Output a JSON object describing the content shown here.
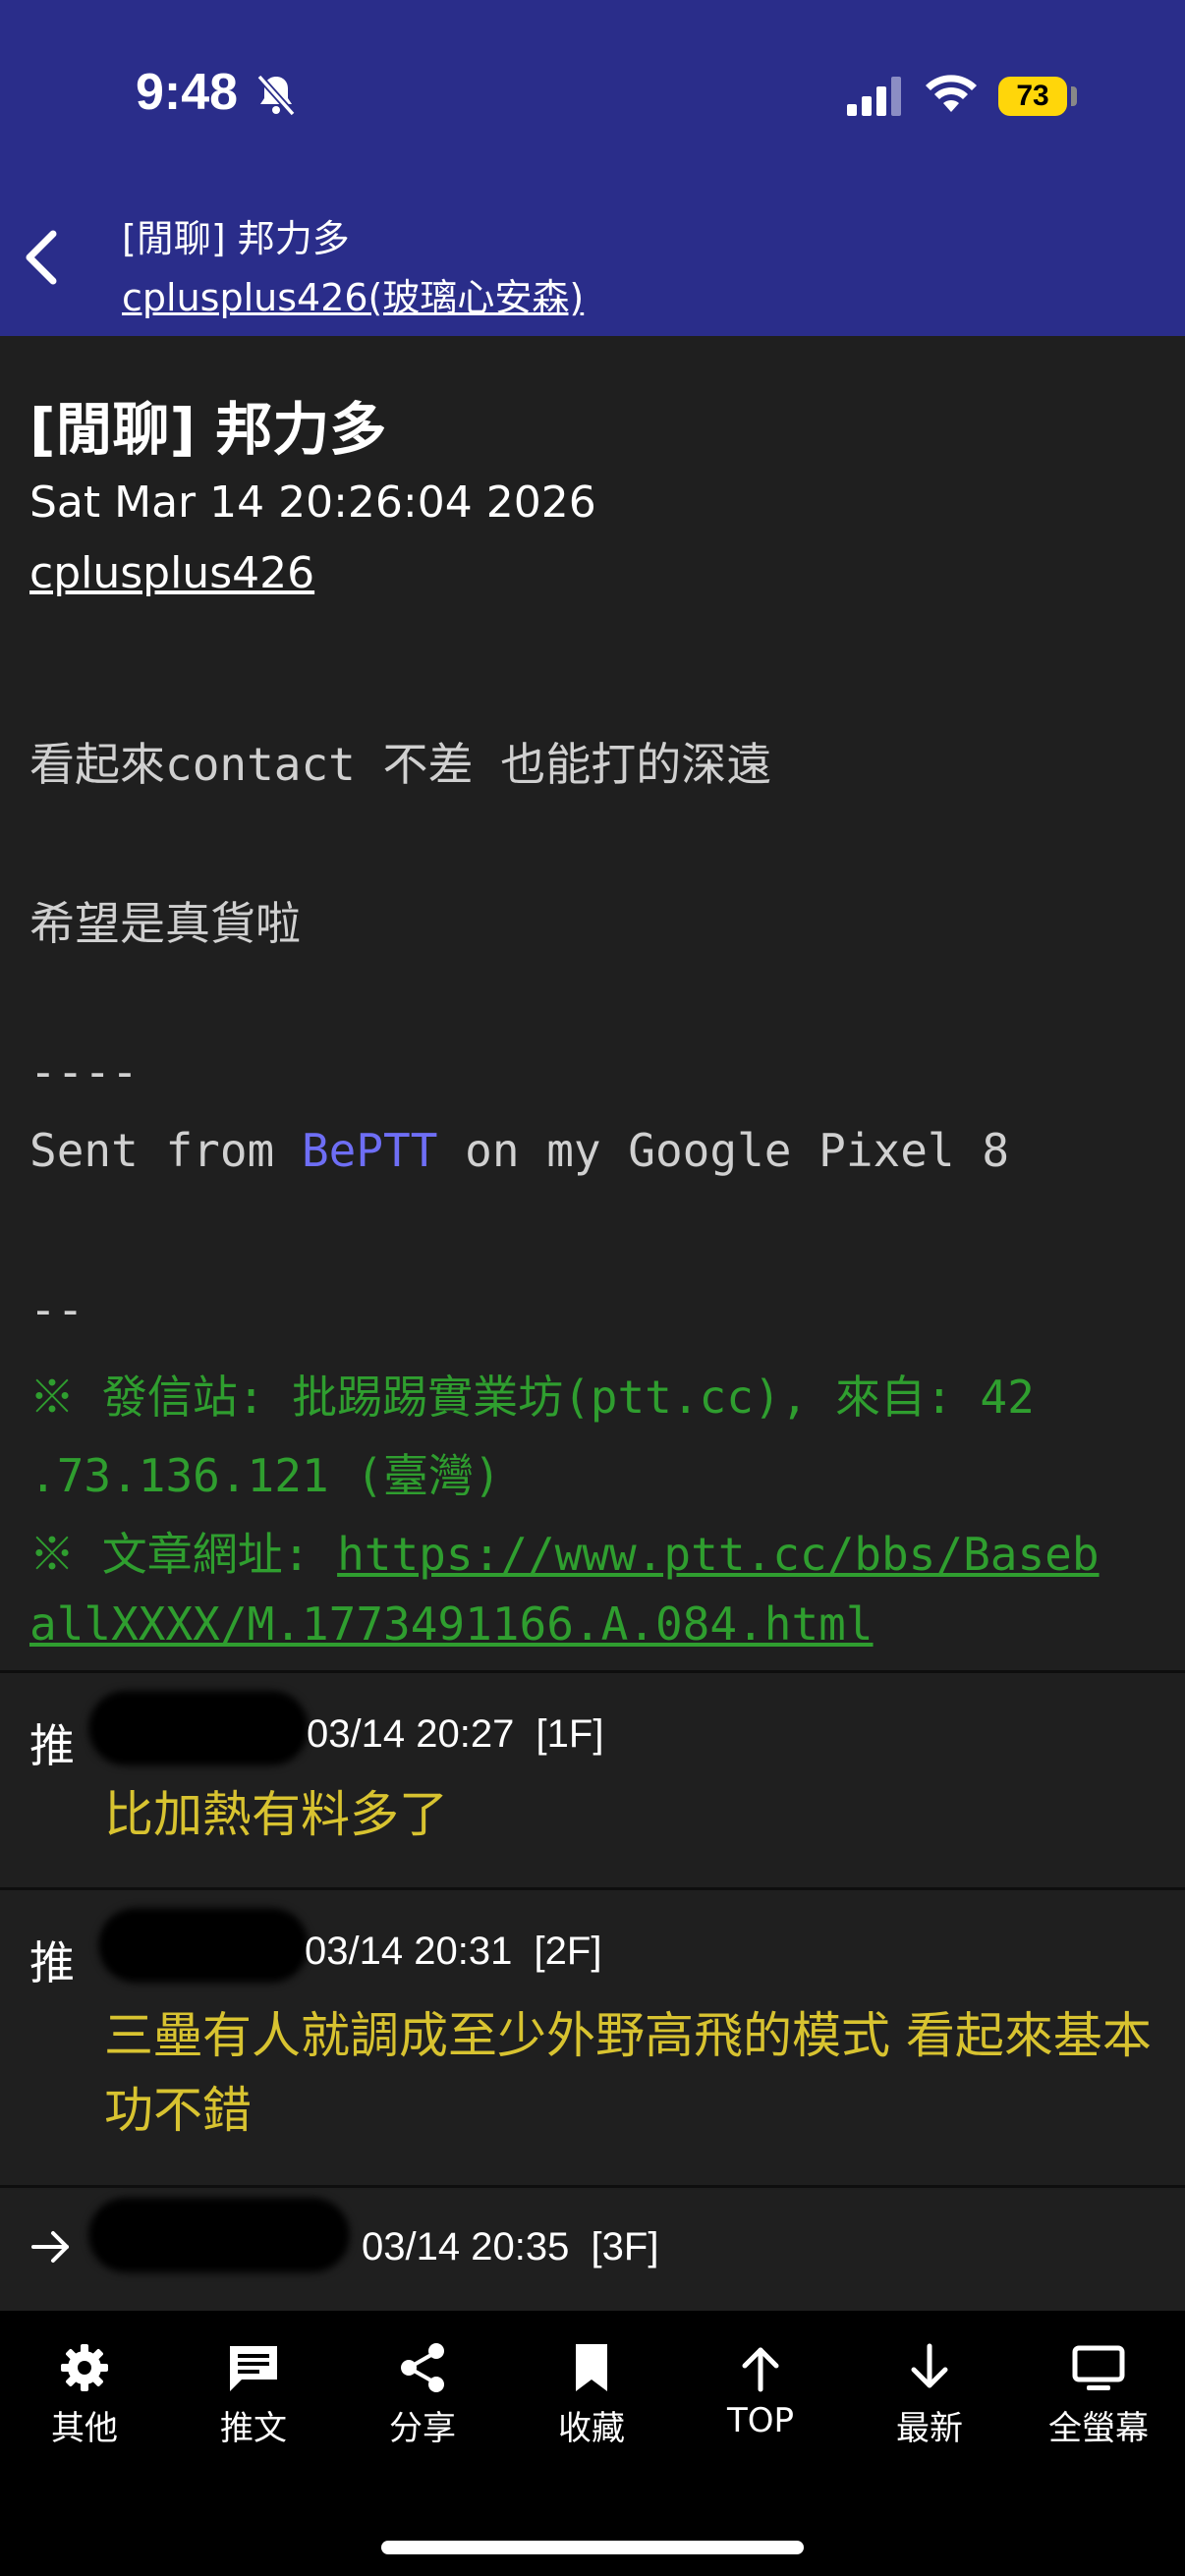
{
  "status_bar": {
    "time": "9:48",
    "battery": "73",
    "icons": [
      "bell-slash-icon",
      "cellular-signal-icon",
      "wifi-icon",
      "battery-icon"
    ]
  },
  "header": {
    "title": "[閒聊] 邦力多",
    "author": "cplusplus426(玻璃心安森)"
  },
  "article": {
    "title": "[閒聊] 邦力多",
    "date": "Sat Mar 14 20:26:04 2026",
    "author": "cplusplus426",
    "body_line1": "看起來contact 不差 也能打的深遠",
    "body_line2": "希望是真貨啦",
    "sep1": "----",
    "sent_prefix": "Sent from ",
    "sent_app": "BePTT",
    "sent_suffix": " on my Google Pixel 8",
    "sep2": "--",
    "origin_line1": "※ 發信站: 批踢踢實業坊(ptt.cc), 來自: 42",
    "origin_line2": ".73.136.121 (臺灣)",
    "url_prefix": "※ 文章網址: ",
    "url_line1": "https://www.ptt.cc/bbs/Baseb",
    "url_line2": "allXXXX/M.1773491166.A.084.html"
  },
  "comments": [
    {
      "tag": "推",
      "time": "03/14 20:27",
      "floor": "[1F]",
      "text": "比加熱有料多了"
    },
    {
      "tag": "推",
      "time": "03/14 20:31",
      "floor": "[2F]",
      "text": "三壘有人就調成至少外野高飛的模式 看起來基本功不錯"
    },
    {
      "tag": "→",
      "time": "03/14 20:35",
      "floor": "[3F]",
      "text": ""
    }
  ],
  "toolbar": {
    "items": [
      {
        "label": "其他",
        "icon": "gear-icon"
      },
      {
        "label": "推文",
        "icon": "comment-icon"
      },
      {
        "label": "分享",
        "icon": "share-icon"
      },
      {
        "label": "收藏",
        "icon": "bookmark-icon"
      },
      {
        "label": "TOP",
        "icon": "arrow-up-icon"
      },
      {
        "label": "最新",
        "icon": "arrow-down-icon"
      },
      {
        "label": "全螢幕",
        "icon": "monitor-icon"
      }
    ]
  },
  "colors": {
    "header_bg": "#2a2d8a",
    "page_bg": "#1f1f1f",
    "push_text": "#d8c330",
    "origin_text": "#2f9e2f",
    "app_link": "#6e6ef5",
    "battery": "#ffd60a"
  }
}
